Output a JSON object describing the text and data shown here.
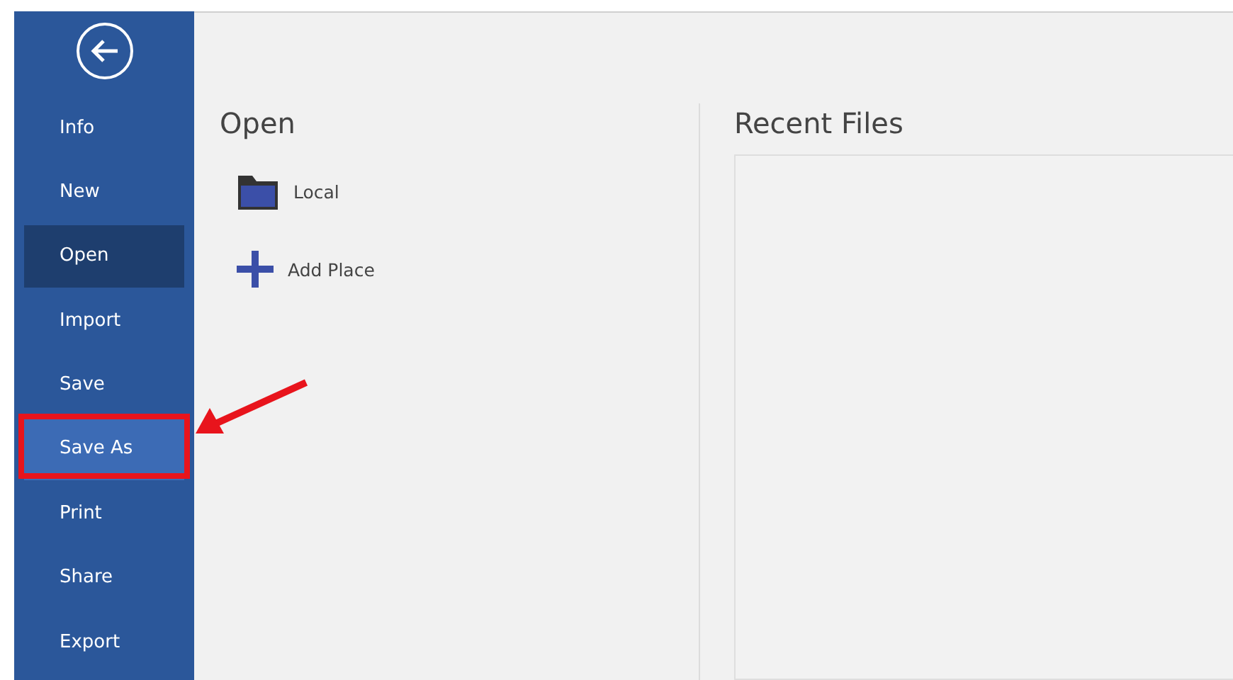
{
  "sidebar": {
    "items": [
      {
        "label": "Info",
        "selected": false,
        "highlighted": false
      },
      {
        "label": "New",
        "selected": false,
        "highlighted": false
      },
      {
        "label": "Open",
        "selected": true,
        "highlighted": false
      },
      {
        "label": "Import",
        "selected": false,
        "highlighted": false
      },
      {
        "label": "Save",
        "selected": false,
        "highlighted": false
      },
      {
        "label": "Save As",
        "selected": false,
        "highlighted": true
      },
      {
        "label": "Print",
        "selected": false,
        "highlighted": false
      },
      {
        "label": "Share",
        "selected": false,
        "highlighted": false
      },
      {
        "label": "Export",
        "selected": false,
        "highlighted": false
      }
    ]
  },
  "open": {
    "title": "Open",
    "places": [
      {
        "kind": "folder",
        "label": "Local"
      },
      {
        "kind": "add",
        "label": "Add Place"
      }
    ]
  },
  "recent": {
    "title": "Recent Files"
  }
}
